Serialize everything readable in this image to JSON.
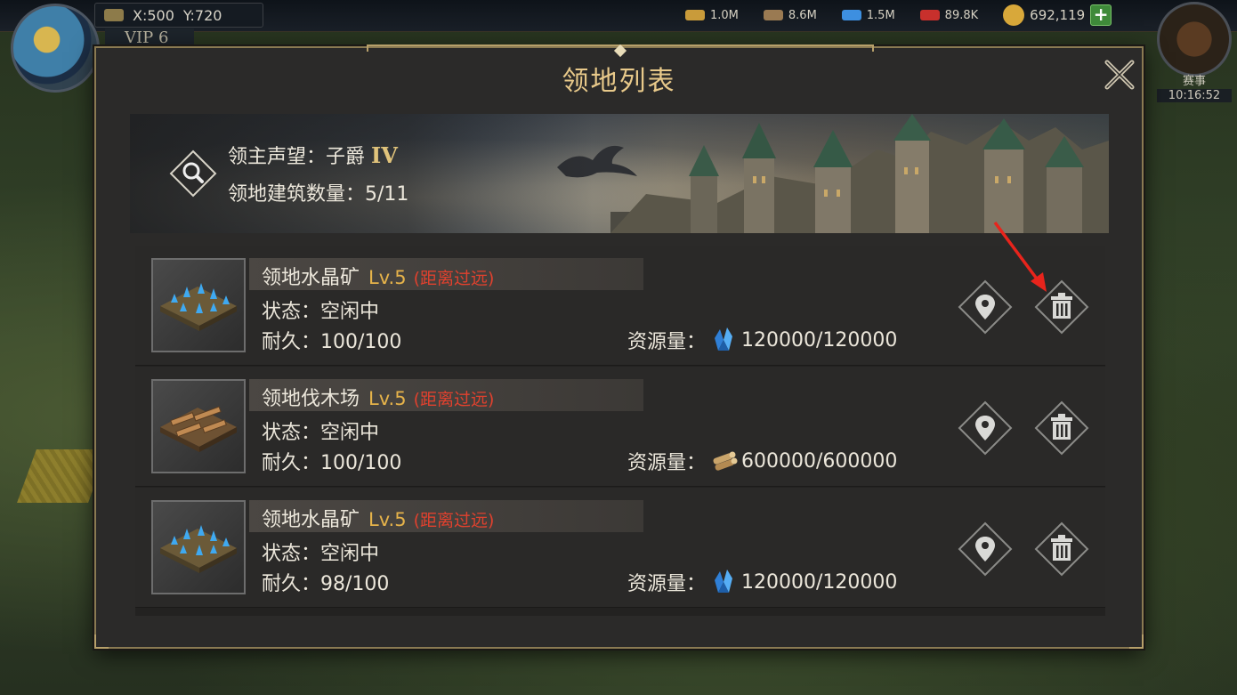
{
  "hud": {
    "coord_x": "X:500",
    "coord_y": "Y:720",
    "vip": "VIP 6",
    "resources": [
      {
        "icon": "food-icon",
        "value": "1.0M",
        "color": "#c99b3a"
      },
      {
        "icon": "wood-icon",
        "value": "8.6M",
        "color": "#9a7a52"
      },
      {
        "icon": "crystal-icon",
        "value": "1.5M",
        "color": "#3d8fe0"
      },
      {
        "icon": "ruby-icon",
        "value": "89.8K",
        "color": "#c8302c"
      }
    ],
    "gold": "692,119",
    "plus_label": "+",
    "event_label": "赛事",
    "event_time": "10:16:52"
  },
  "modal": {
    "title": "领地列表",
    "banner": {
      "prestige_label": "领主声望：子爵",
      "prestige_rank": "IV",
      "building_count_label": "领地建筑数量：5/11"
    },
    "rows": [
      {
        "name": "领地水晶矿",
        "level": "Lv.5",
        "distance": "(距离过远)",
        "status": "状态：空闲中",
        "durability": "耐久：100/100",
        "resource_label": "资源量：",
        "resource_value": "120000/120000",
        "resource_icon": "crystal-icon",
        "thumb_icon": "crystal-mine-icon"
      },
      {
        "name": "领地伐木场",
        "level": "Lv.5",
        "distance": "(距离过远)",
        "status": "状态：空闲中",
        "durability": "耐久：100/100",
        "resource_label": "资源量：",
        "resource_value": "600000/600000",
        "resource_icon": "wood-icon",
        "thumb_icon": "lumber-mill-icon"
      },
      {
        "name": "领地水晶矿",
        "level": "Lv.5",
        "distance": "(距离过远)",
        "status": "状态：空闲中",
        "durability": "耐久：98/100",
        "resource_label": "资源量：",
        "resource_value": "120000/120000",
        "resource_icon": "crystal-icon",
        "thumb_icon": "crystal-mine-icon"
      }
    ]
  },
  "colors": {
    "title": "#e8c98a",
    "level": "#e6b34a",
    "distance_warning": "#e0412e",
    "annotation_arrow": "#e8241c"
  }
}
